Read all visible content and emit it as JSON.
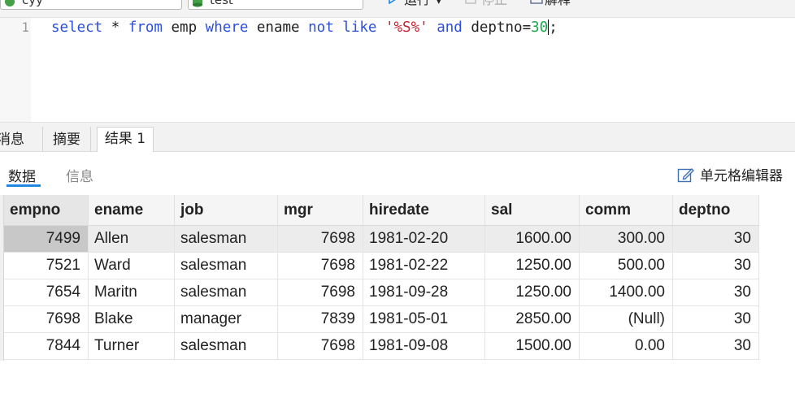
{
  "toolbar": {
    "connection": "cyy",
    "database": "test",
    "run_label": "运行",
    "stop_label": "停止",
    "explain_label": "解释"
  },
  "editor": {
    "line_number": "1",
    "tokens": {
      "select": "select",
      "star": " * ",
      "from": "from",
      "emp": " emp ",
      "where": "where",
      "ename": " ename ",
      "not": "not",
      "like": "like",
      "pattern": "'%S%'",
      "and": "and",
      "deptno": " deptno=",
      "value": "30",
      "semicolon": ";"
    }
  },
  "result_tabs": [
    "消息",
    "摘要",
    "结果 1"
  ],
  "sub_tabs": {
    "data": "数据",
    "info": "信息"
  },
  "cell_editor_label": "单元格编辑器",
  "table": {
    "columns": [
      "empno",
      "ename",
      "job",
      "mgr",
      "hiredate",
      "sal",
      "comm",
      "deptno"
    ],
    "rows": [
      [
        "7499",
        "Allen",
        "salesman",
        "7698",
        "1981-02-20",
        "1600.00",
        "300.00",
        "30"
      ],
      [
        "7521",
        "Ward",
        "salesman",
        "7698",
        "1981-02-22",
        "1250.00",
        "500.00",
        "30"
      ],
      [
        "7654",
        "Maritn",
        "salesman",
        "7698",
        "1981-09-28",
        "1250.00",
        "1400.00",
        "30"
      ],
      [
        "7698",
        "Blake",
        "manager",
        "7839",
        "1981-05-01",
        "2850.00",
        "(Null)",
        "30"
      ],
      [
        "7844",
        "Turner",
        "salesman",
        "7698",
        "1981-09-08",
        "1500.00",
        "0.00",
        "30"
      ]
    ]
  },
  "colors": {
    "keyword": "#2b4fd8",
    "string": "#c8202f",
    "number": "#19a84a",
    "accent": "#1e88e5",
    "null_text": "#b9b9b9"
  }
}
